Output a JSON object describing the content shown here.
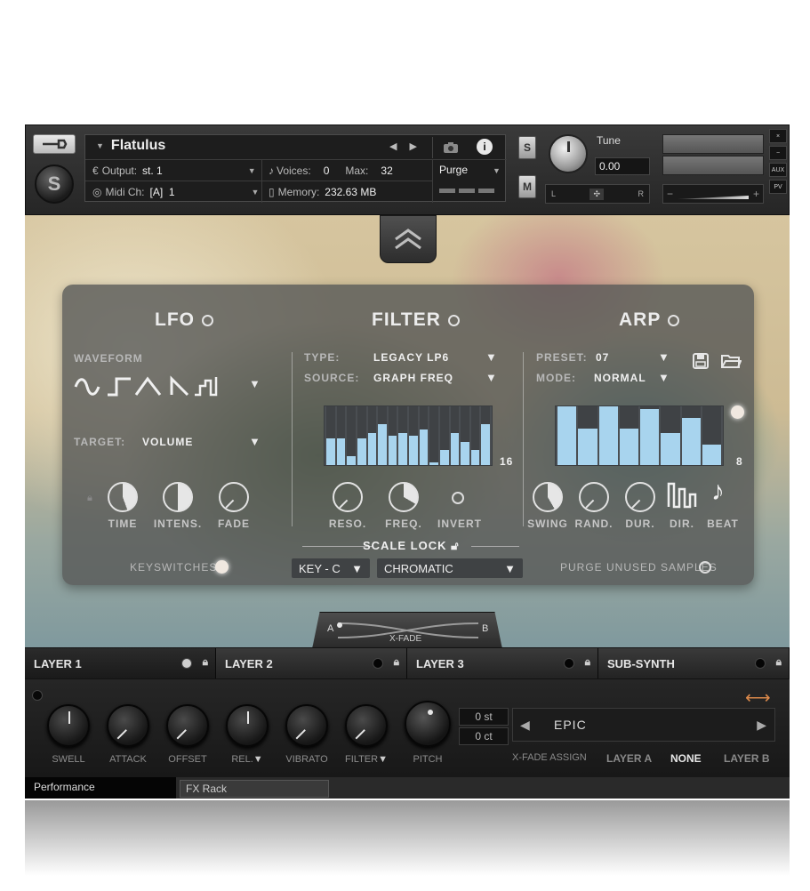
{
  "header": {
    "instrument_name": "Flatulus",
    "output_label": "Output:",
    "output_value": "st. 1",
    "midi_label": "Midi Ch:",
    "midi_value": "[A]  1",
    "voices_label": "Voices:",
    "voices_value": "0",
    "max_label": "Max:",
    "max_value": "32",
    "memory_label": "Memory:",
    "memory_value": "232.63 MB",
    "purge_label": "Purge",
    "s_button": "S",
    "m_button": "M",
    "tune_label": "Tune",
    "tune_value": "0.00",
    "pan_left": "L",
    "pan_right": "R",
    "vol_minus": "−",
    "vol_plus": "+",
    "side_buttons": [
      "×",
      "−",
      "AUX",
      "PV"
    ]
  },
  "lfo": {
    "title": "LFO",
    "waveform_label": "WAVEFORM",
    "target_label": "TARGET:",
    "target_value": "VOLUME",
    "knobs": [
      {
        "label": "TIME",
        "level": 0.45
      },
      {
        "label": "INTENS.",
        "level": 0.5
      },
      {
        "label": "FADE",
        "level": 0.0
      }
    ],
    "keyswitches_label": "KEYSWITCHES:"
  },
  "filter": {
    "title": "FILTER",
    "type_label": "TYPE:",
    "type_value": "LEGACY LP6",
    "source_label": "SOURCE:",
    "source_value": "GRAPH FREQ",
    "steps": "16",
    "graph_values": [
      0.45,
      0.45,
      0.15,
      0.45,
      0.55,
      0.7,
      0.5,
      0.55,
      0.5,
      0.6,
      0.05,
      0.25,
      0.55,
      0.4,
      0.25,
      0.7
    ],
    "knobs": [
      {
        "label": "RESO.",
        "level": 0.0
      },
      {
        "label": "FREQ.",
        "level": 0.35
      }
    ],
    "invert_label": "INVERT"
  },
  "arp": {
    "title": "ARP",
    "preset_label": "PRESET:",
    "preset_value": "07",
    "mode_label": "MODE:",
    "mode_value": "NORMAL",
    "steps": "8",
    "graph_values": [
      1.0,
      0.62,
      1.0,
      0.62,
      0.95,
      0.55,
      0.8,
      0.35
    ],
    "knobs": [
      {
        "label": "SWING",
        "level": 0.4
      },
      {
        "label": "RAND.",
        "level": 0.0
      },
      {
        "label": "DUR.",
        "level": 0.0
      }
    ],
    "dir_label": "DIR.",
    "beat_label": "BEAT",
    "purge_unused_label": "PURGE UNUSED SAMPLES"
  },
  "scale_lock": {
    "label": "SCALE LOCK",
    "key_value": "KEY - C",
    "scale_value": "CHROMATIC"
  },
  "xfade": {
    "label": "X-FADE",
    "a": "A",
    "b": "B"
  },
  "layers": [
    "LAYER 1",
    "LAYER 2",
    "LAYER 3",
    "SUB-SYNTH"
  ],
  "performance": {
    "knobs": [
      {
        "label": "SWELL"
      },
      {
        "label": "ATTACK"
      },
      {
        "label": "OFFSET"
      },
      {
        "label": "REL."
      },
      {
        "label": "VIBRATO"
      },
      {
        "label": "FILTER"
      },
      {
        "label": "PITCH"
      }
    ],
    "st_value": "0 st",
    "ct_value": "0 ct",
    "preset_value": "EPIC",
    "xfade_assign_label": "X-FADE ASSIGN",
    "assign_options": [
      "LAYER A",
      "NONE",
      "LAYER B"
    ]
  },
  "bottom_tabs": {
    "performance": "Performance",
    "fx_rack": "FX Rack"
  },
  "colors": {
    "graph_bar": "#a8d4ee",
    "panel": "#565856"
  }
}
